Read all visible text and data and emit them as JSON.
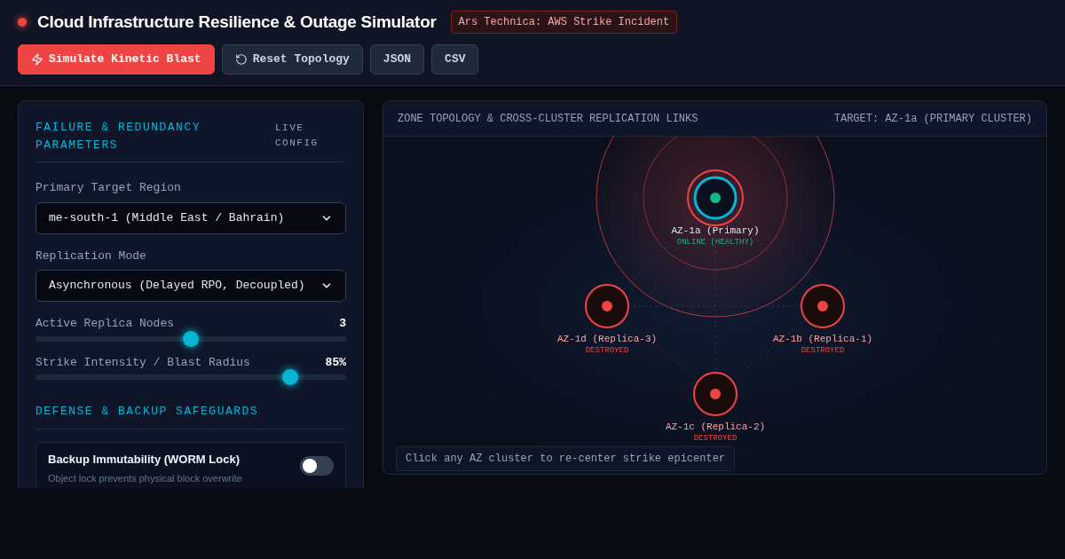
{
  "header": {
    "title": "Cloud Infrastructure Resilience & Outage Simulator",
    "source_tag": "Ars Technica: AWS Strike Incident",
    "buttons": [
      {
        "label": "Simulate Kinetic Blast",
        "kind": "danger"
      },
      {
        "label": "Reset Topology",
        "kind": "reset"
      },
      {
        "label": "JSON",
        "kind": "plain"
      },
      {
        "label": "CSV",
        "kind": "plain"
      }
    ]
  },
  "parameters": {
    "title": "FAILURE & REDUNDANCY PARAMETERS",
    "badge": "LIVE CONFIG",
    "fields": [
      {
        "kind": "select",
        "label": "Primary Target Region",
        "value": "me-south-1 (Middle East / Bahrain)"
      },
      {
        "kind": "select",
        "label": "Replication Mode",
        "value": "Asynchronous (Delayed RPO, Decoupled)"
      },
      {
        "kind": "slider",
        "label": "Active Replica Nodes",
        "reading": "3",
        "level": 0.5
      },
      {
        "kind": "slider",
        "label": "Strike Intensity / Blast Radius",
        "reading": "85%",
        "level": 0.82
      }
    ],
    "safeguards_title": "DEFENSE & BACKUP SAFEGUARDS",
    "safeguards": [
      {
        "title": "Backup Immutability (WORM Lock)",
        "description": "Object lock prevents physical block overwrite",
        "on": false
      }
    ]
  },
  "topology": {
    "title": "ZONE TOPOLOGY & CROSS-CLUSTER REPLICATION LINKS",
    "target": "TARGET: AZ-1a (PRIMARY CLUSTER)",
    "nodes": [
      {
        "name": "AZ-1a (Primary)",
        "status": "ONLINE (HEALTHY)",
        "kind": "primary",
        "destroyed": false
      },
      {
        "name": "AZ-1d (Replica-3)",
        "status": "DESTROYED",
        "kind": "replica",
        "destroyed": true
      },
      {
        "name": "AZ-1b (Replica-1)",
        "status": "DESTROYED",
        "kind": "replica",
        "destroyed": true
      },
      {
        "name": "AZ-1c (Replica-2)",
        "status": "DESTROYED",
        "kind": "replica",
        "destroyed": true
      }
    ],
    "hint": "Click any AZ cluster to re-center strike epicenter"
  }
}
